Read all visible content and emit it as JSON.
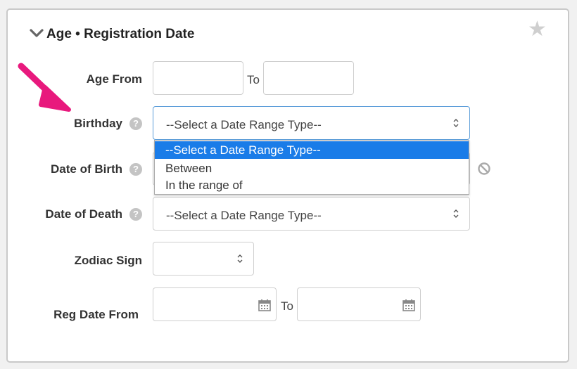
{
  "section": {
    "title": "Age • Registration Date",
    "collapse_icon": "chevron-down-icon",
    "favorite_icon": "star-icon"
  },
  "fields": {
    "age_from_label": "Age From",
    "age_to_label": "To",
    "birthday_label": "Birthday",
    "birthday_value": "--Select a Date Range Type--",
    "date_of_birth_label": "Date of Birth",
    "date_of_death_label": "Date of Death",
    "date_of_death_value": "--Select a Date Range Type--",
    "zodiac_sign_label": "Zodiac Sign",
    "zodiac_sign_value": "",
    "reg_date_from_label": "Reg Date From",
    "reg_date_to_label": "To"
  },
  "dropdown": {
    "options": [
      "--Select a Date Range Type--",
      "Between",
      "In the range of"
    ],
    "selected_index": 0
  },
  "colors": {
    "highlight": "#1a7ce8",
    "arrow": "#e8197d",
    "focus_border": "#5b9dd9"
  }
}
